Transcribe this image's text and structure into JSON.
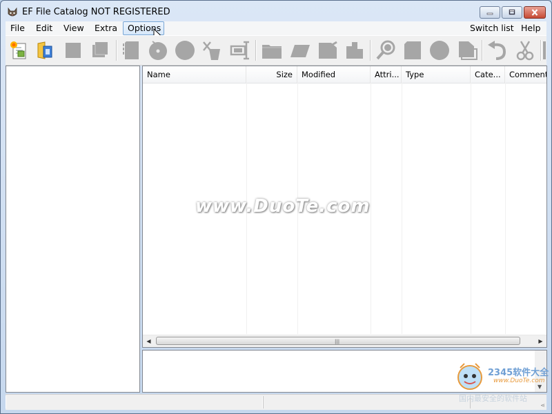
{
  "window": {
    "title": "EF File Catalog NOT REGISTERED",
    "controls": [
      "minimize-icon",
      "maximize-icon",
      "close-icon"
    ]
  },
  "menubar": {
    "items": [
      {
        "label": "File"
      },
      {
        "label": "Edit"
      },
      {
        "label": "View"
      },
      {
        "label": "Extra"
      },
      {
        "label": "Options",
        "active": true
      }
    ],
    "right_items": [
      {
        "label": "Switch list"
      },
      {
        "label": "Help"
      }
    ]
  },
  "toolbar": {
    "icons": [
      "new-catalog-icon",
      "open-folder-icon",
      "square-icon",
      "copy-squares-icon",
      "disk-icon",
      "cd-icon",
      "circle-icon",
      "cut-cup-icon",
      "sort-icon",
      "folder-icon",
      "tag-icon",
      "note-icon",
      "puzzle-icon",
      "search-icon",
      "page-icon",
      "circle-icon",
      "document-icon",
      "undo-icon",
      "scissors-icon"
    ]
  },
  "file_list": {
    "columns": [
      {
        "label": "Name"
      },
      {
        "label": "Size"
      },
      {
        "label": "Modified"
      },
      {
        "label": "Attri..."
      },
      {
        "label": "Type"
      },
      {
        "label": "Cate..."
      },
      {
        "label": "Comment"
      }
    ],
    "rows": [],
    "hscroll_grip": "|||"
  },
  "watermark": {
    "text": "www.DuoTe.com"
  },
  "corner_logo": {
    "text": "2345软件大全",
    "url": "www.DuoTe.com",
    "sub": "国内最安全的软件站"
  },
  "colors": {
    "accent": "#7aa7d6",
    "title_gradient_top": "#dbe7f6",
    "close_button": "#c74a34",
    "toolbar_icon": "#a6a6a6"
  }
}
